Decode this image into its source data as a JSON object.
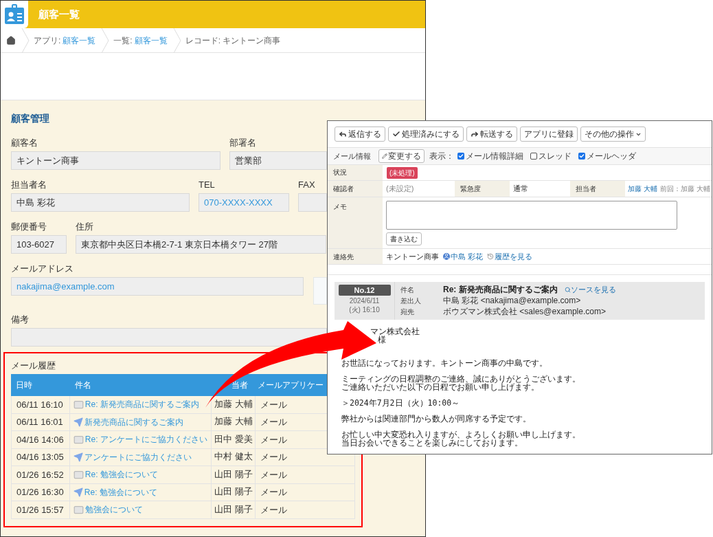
{
  "app_window": {
    "title": "顧客一覧",
    "breadcrumbs": [
      {
        "prefix": "アプリ:",
        "link": "顧客一覧"
      },
      {
        "prefix": "一覧:",
        "link": "顧客一覧"
      },
      {
        "prefix": "レコード: キントーン商事"
      }
    ],
    "section_title": "顧客管理",
    "field_rows": [
      [
        {
          "label": "顧客名",
          "value": "キントーン商事"
        },
        {
          "label": "部署名",
          "value": "営業部"
        }
      ],
      [
        {
          "label": "担当者名",
          "value": "中島 彩花"
        },
        {
          "label": "TEL",
          "value": "070-XXXX-XXXX",
          "link": true
        },
        {
          "label": "FAX"
        }
      ],
      [
        {
          "label": "郵便番号",
          "value": "103-6027"
        },
        {
          "label": "住所",
          "value": "東京都中央区日本橋2-7-1 東京日本橋タワー 27階"
        }
      ],
      [
        {
          "label": "メールアドレス",
          "value": "nakajima@example.com",
          "link": true
        }
      ],
      [
        {
          "label": "備考"
        }
      ]
    ],
    "mail_history": {
      "title": "メール履歴",
      "columns": [
        "日時",
        "件名",
        "当者",
        "メールアプリケー"
      ],
      "rows": [
        {
          "date": "06/11 16:10",
          "kind": "received",
          "subject": "Re: 新発売商品に関するご案内",
          "owner": "加藤 大輔",
          "app": "メール"
        },
        {
          "date": "06/11 16:01",
          "kind": "sent",
          "subject": "新発売商品に関するご案内",
          "owner": "加藤 大輔",
          "app": "メール"
        },
        {
          "date": "04/16 14:06",
          "kind": "received",
          "subject": "Re: アンケートにご協力ください",
          "owner": "田中 愛美",
          "app": "メール"
        },
        {
          "date": "04/16 13:05",
          "kind": "sent",
          "subject": "アンケートにご協力ください",
          "owner": "中村 健太",
          "app": "メール"
        },
        {
          "date": "01/26 16:52",
          "kind": "received",
          "subject": "Re: 勉強会について",
          "owner": "山田 陽子",
          "app": "メール"
        },
        {
          "date": "01/26 16:30",
          "kind": "sent",
          "subject": "Re: 勉強会について",
          "owner": "山田 陽子",
          "app": "メール"
        },
        {
          "date": "01/26 15:57",
          "kind": "received",
          "subject": "勉強会について",
          "owner": "山田 陽子",
          "app": "メール"
        }
      ]
    }
  },
  "mail_window": {
    "toolbar": [
      {
        "label": "返信する",
        "kind": "reply"
      },
      {
        "label": "処理済みにする",
        "kind": "check"
      },
      {
        "label": "転送する",
        "kind": "forward"
      },
      {
        "label": "アプリに登録",
        "kind": "text"
      },
      {
        "label": "その他の操作",
        "kind": "text",
        "dropdown": true
      }
    ],
    "info_bar": {
      "title": "メール情報",
      "change_button": "変更する",
      "display_label": "表示：",
      "options": [
        {
          "label": "メール情報詳細",
          "checked": true
        },
        {
          "label": "スレッド",
          "checked": false
        },
        {
          "label": "メールヘッダ",
          "checked": true
        }
      ]
    },
    "status": {
      "label": "状況",
      "badge": "(未処理)"
    },
    "details": {
      "confirmer_label": "確認者",
      "confirmer": "(未設定)",
      "priority_label": "緊急度",
      "priority": "通常",
      "owner_label": "担当者",
      "owner": "加藤 大輔",
      "previous": "前回：加藤 大輔"
    },
    "memo": {
      "label": "メモ",
      "button": "書き込む"
    },
    "contact": {
      "label": "連絡先",
      "company": "キントーン商事",
      "person": "中島 彩花",
      "history_link": "履歴を見る"
    },
    "message": {
      "number": "No.12",
      "date": "2024/6/11",
      "time": "(火) 16:10",
      "headers": [
        {
          "label": "件名",
          "value": "Re: 新発売商品に関するご案内",
          "link": "ソースを見る"
        },
        {
          "label": "差出人",
          "value": "中島 彩花 <nakajima@example.com>"
        },
        {
          "label": "宛先",
          "value": "ボウズマン株式会社 <sales@example.com>"
        }
      ],
      "body": [
        [
          "マン株式会社",
          "様"
        ],
        [
          "お世話になっております。キントーン商事の中島です。"
        ],
        [
          "ミーティングの日程調整のご連絡、誠にありがとうございます。",
          "ご連絡いただいた以下の日程でお願い申し上げます。"
        ],
        [
          "＞2024年7月2日（火）10:00～"
        ],
        [
          "弊社からは関連部門から数人が同席する予定です。"
        ],
        [
          "お忙しい中大変恐れ入りますが、よろしくお願い申し上げます。",
          "当日お会いできることを楽しみにしております。"
        ]
      ]
    }
  }
}
